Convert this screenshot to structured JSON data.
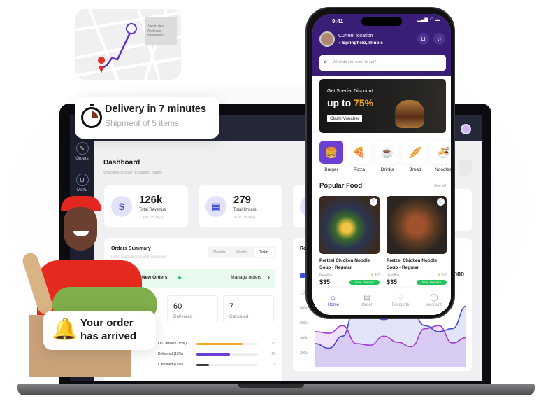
{
  "map": {
    "poi_label": "Jardin des Archives nationales"
  },
  "delivery_toast": {
    "title": "Delivery in 7 minutes",
    "subtitle": "Shipment of 5 items"
  },
  "arrival_toast": {
    "title_line1": "Your order",
    "title_line2": "has arrived"
  },
  "dashboard": {
    "sidebar": [
      {
        "label": "Orders",
        "icon": "orders-icon"
      },
      {
        "label": "Menu",
        "icon": "menu-icon"
      }
    ],
    "title": "Dashboard",
    "subtitle": "Welcome to your restaurant panel!",
    "stats": [
      {
        "value": "126k",
        "label": "Total Revenue",
        "trend": "28% (30 days)",
        "trend_dir": "down"
      },
      {
        "value": "279",
        "label": "Total Orders",
        "trend": "4% (30 days)",
        "trend_dir": "up"
      }
    ],
    "orders_summary": {
      "title": "Orders Summary",
      "subtitle": "Lorem ipsum dolor sit amet, consectetur",
      "tabs": [
        "Monthly",
        "Weekly",
        "Today"
      ],
      "active_tab": "Today",
      "new_orders": "New Orders",
      "manage": "Manage orders",
      "counts": [
        {
          "value": "60",
          "label": "Delivered"
        },
        {
          "value": "7",
          "label": "Canceled"
        }
      ],
      "bars": [
        {
          "label": "On Delivery (15%)",
          "value": "25",
          "fill": 0.75,
          "color": "#f5a623"
        },
        {
          "label": "Delivered (15%)",
          "value": "60",
          "fill": 0.55,
          "color": "#6a3ed1"
        },
        {
          "label": "Canceled (15%)",
          "value": "7",
          "fill": 0.2,
          "color": "#3a3a44"
        }
      ]
    },
    "revenue": {
      "title_partial": "Re",
      "big_partial": "000",
      "y_ticks": [
        "1,000k",
        "800k",
        "600k",
        "400k",
        "200k"
      ],
      "series": [
        {
          "color": "#3d4fd6",
          "values": [
            320,
            260,
            420,
            900,
            700,
            640,
            720,
            760,
            560,
            480,
            520,
            820
          ]
        },
        {
          "color": "#a43ad6",
          "values": [
            480,
            460,
            560,
            320,
            300,
            420,
            340,
            280,
            520,
            560,
            330,
            400
          ]
        }
      ]
    }
  },
  "phone": {
    "time": "9:41",
    "location_label": "Current location",
    "location": "Springfield, Illinois",
    "search_placeholder": "What do you want to eat?",
    "promo": {
      "line1": "Get Special Discount",
      "prefix": "up to ",
      "percent": "75%",
      "button": "Claim Voucher"
    },
    "categories": [
      {
        "label": "Burger",
        "icon": "🍔"
      },
      {
        "label": "Pizza",
        "icon": "🍕"
      },
      {
        "label": "Drinks",
        "icon": "☕"
      },
      {
        "label": "Bread",
        "icon": "🥖"
      },
      {
        "label": "Noodles",
        "icon": "🍜"
      }
    ],
    "popular_title": "Popular Food",
    "see_all": "See all",
    "foods": [
      {
        "name": "Pretzel Chicken Noodle Soup - Regular",
        "category": "Noodles",
        "rating": "4.7",
        "price": "$35",
        "badge": "Free Delivery"
      },
      {
        "name": "Pretzel Chicken Noodle Soup - Regular",
        "category": "Noodles",
        "rating": "4.7",
        "price": "$35",
        "badge": "Free Delivery"
      }
    ],
    "nav": [
      {
        "label": "Home",
        "icon": "⌂"
      },
      {
        "label": "Order",
        "icon": "▤"
      },
      {
        "label": "Favourite",
        "icon": "♡"
      },
      {
        "label": "Account",
        "icon": "◯"
      }
    ],
    "accent": "#3a1d77",
    "promo_accent": "#f5a623"
  }
}
